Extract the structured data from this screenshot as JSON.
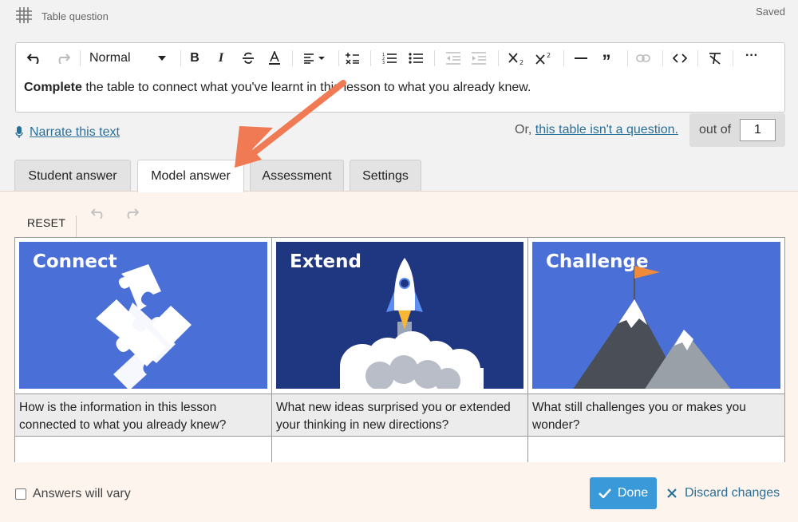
{
  "header": {
    "question_type": "Table question",
    "status": "Saved"
  },
  "editor": {
    "style_select": "Normal",
    "text_bold": "Complete",
    "text_rest": " the table to connect what you've learnt in this lesson to what you already knew."
  },
  "narrate": {
    "label": "Narrate this text"
  },
  "question_toggle": {
    "prefix": "Or, ",
    "link": "this table isn't a question."
  },
  "marks": {
    "label": "out of",
    "value": "1"
  },
  "tabs": [
    {
      "label": "Student answer",
      "active": false
    },
    {
      "label": "Model answer",
      "active": true
    },
    {
      "label": "Assessment",
      "active": false
    },
    {
      "label": "Settings",
      "active": false
    }
  ],
  "panel": {
    "reset_label": "RESET"
  },
  "table": {
    "columns": [
      {
        "image_title": "Connect",
        "prompt": "How is the information in this lesson connected to what you already knew?",
        "answer": ""
      },
      {
        "image_title": "Extend",
        "prompt": "What new ideas surprised you or extended your thinking in new directions?",
        "answer": ""
      },
      {
        "image_title": "Challenge",
        "prompt": "What still challenges you or makes you wonder?",
        "answer": ""
      }
    ]
  },
  "footer": {
    "answers_vary_label": "Answers will vary",
    "answers_vary_checked": false,
    "done_label": "Done",
    "discard_label": "Discard changes"
  },
  "colors": {
    "accent": "#3a9ad9",
    "link": "#2a6f97",
    "panel_bg": "#fdf4ee",
    "connect_bg": "#4a6fd6",
    "extend_bg": "#1f3680",
    "challenge_bg": "#4a6fd6",
    "annotation_arrow": "#f07a53"
  }
}
